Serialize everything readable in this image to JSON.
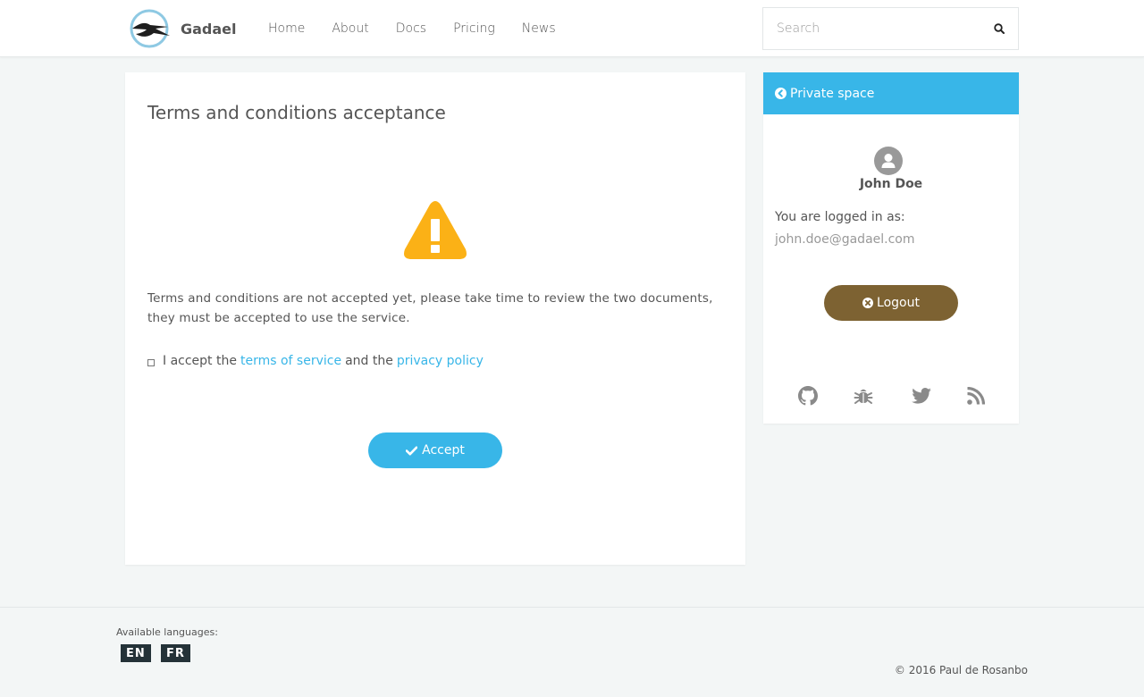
{
  "navbar": {
    "brand_name": "Gadael",
    "links": [
      "Home",
      "About",
      "Docs",
      "Pricing",
      "News"
    ],
    "search_placeholder": "Search"
  },
  "main": {
    "title": "Terms and conditions acceptance",
    "message": "Terms and conditions are not accepted yet, please take time to review the two documents, they must be accepted to use the service.",
    "accept_prefix": "I accept the",
    "terms_link": "terms of service",
    "conjunction": "and the",
    "privacy_link": "privacy policy",
    "accept_button": "Accept"
  },
  "sidebar": {
    "header": "Private space",
    "user_name": "John Doe",
    "logged_in_label": "You are logged in as:",
    "email": "john.doe@gadael.com",
    "logout_button": "Logout",
    "social_icons": [
      "github-icon",
      "bug-icon",
      "twitter-icon",
      "rss-icon"
    ]
  },
  "footer": {
    "languages_label": "Available languages:",
    "languages": [
      "EN",
      "FR"
    ],
    "copyright": "© 2016 Paul de Rosanbo"
  },
  "colors": {
    "accent": "#38b6e8",
    "logout": "#7d6232",
    "warning": "#fbb116",
    "lang_badge": "#243238"
  }
}
